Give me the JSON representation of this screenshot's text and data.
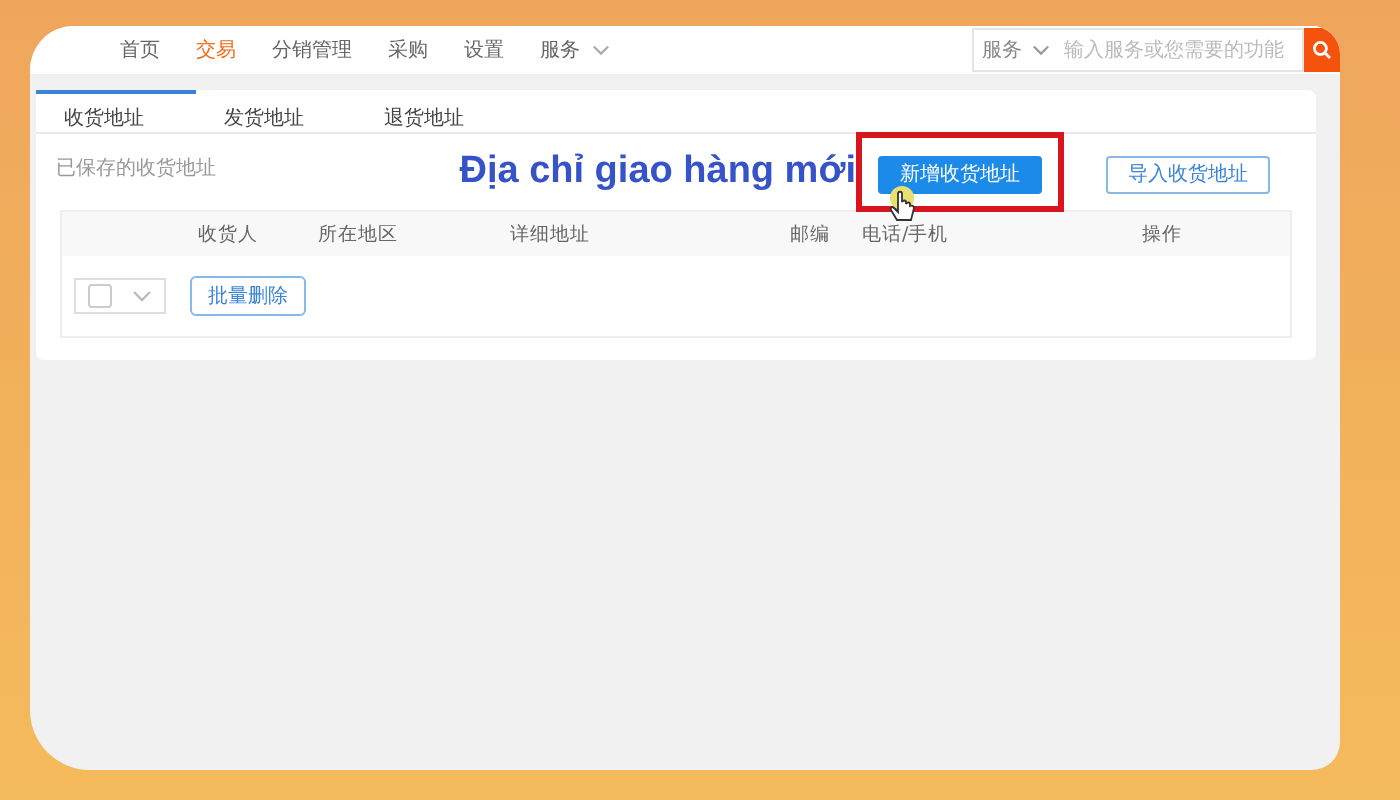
{
  "nav": {
    "items": [
      {
        "label": "首页",
        "selected": false,
        "has_menu": false
      },
      {
        "label": "交易",
        "selected": true,
        "has_menu": false
      },
      {
        "label": "分销管理",
        "selected": false,
        "has_menu": false
      },
      {
        "label": "采购",
        "selected": false,
        "has_menu": false
      },
      {
        "label": "设置",
        "selected": false,
        "has_menu": false
      },
      {
        "label": "服务",
        "selected": false,
        "has_menu": true
      }
    ]
  },
  "search": {
    "scope": "服务",
    "placeholder": "输入服务或您需要的功能"
  },
  "tabs": [
    {
      "label": "收货地址",
      "selected": true
    },
    {
      "label": "发货地址",
      "selected": false
    },
    {
      "label": "退货地址",
      "selected": false
    }
  ],
  "saved_label": "已保存的收货地址",
  "caption": "Địa chỉ giao hàng mới",
  "buttons": [
    {
      "label": "新增收货地址",
      "kind": "primary",
      "highlighted": true
    },
    {
      "label": "导入收货地址",
      "kind": "outline",
      "highlighted": false
    }
  ],
  "table": {
    "columns": [
      "收货人",
      "所在地区",
      "详细地址",
      "邮编",
      "电话/手机",
      "操作"
    ]
  },
  "bulk": {
    "checked": false,
    "button": "批量删除"
  }
}
